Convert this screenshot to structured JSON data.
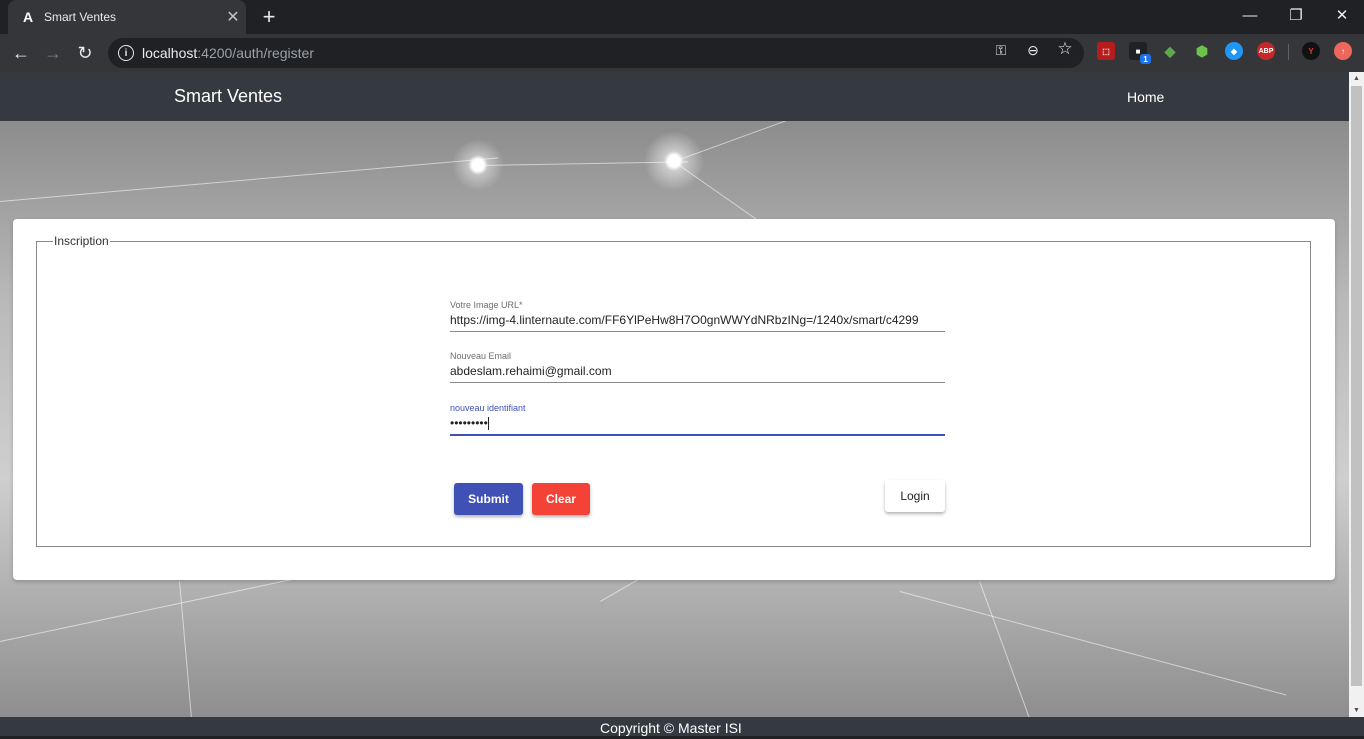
{
  "browser": {
    "tab_title": "Smart Ventes",
    "tab_favicon": "A",
    "url_host": "localhost",
    "url_path": ":4200/auth/register",
    "extensions": [
      "pdf-icon",
      "box-icon",
      "puzzle-icon",
      "node-icon",
      "drop-icon",
      "ABP",
      "y-icon",
      "update-icon"
    ],
    "ext_abp_label": "ABP",
    "ext_badge": "1"
  },
  "navbar": {
    "brand": "Smart Ventes",
    "home_link": "Home"
  },
  "form": {
    "legend": "Inscription",
    "image_url_label": "Votre Image URL*",
    "image_url_value": "https://img-4.linternaute.com/FF6YlPeHw8H7O0gnWWYdNRbzINg=/1240x/smart/c4299",
    "email_label": "Nouveau Email",
    "email_value": "abdeslam.rehaimi@gmail.com",
    "id_label": "nouveau identifiant",
    "id_value": "•••••••••",
    "submit_label": "Submit",
    "clear_label": "Clear",
    "login_label": "Login"
  },
  "footer": {
    "text": "Copyright © Master ISI"
  },
  "colors": {
    "primary": "#3f51b5",
    "warn": "#f44336",
    "navbar": "#343a40"
  }
}
